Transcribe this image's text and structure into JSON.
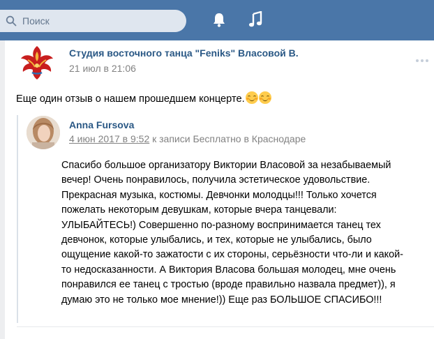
{
  "header": {
    "search_placeholder": "Поиск",
    "bar_color": "#4a76a8"
  },
  "post": {
    "author": "Студия восточного танца \"Feniks\" Власовой В.",
    "date": "21 июл в 21:06",
    "text": "Еще один отзыв о нашем прошедшем концерте."
  },
  "repost": {
    "author": "Anna Fursova",
    "date": "4 июн 2017 в 9:52",
    "context": "к записи Бесплатно в Краснодаре",
    "text": "Спасибо большое организатору Виктории Власовой за незабываемый\nвечер! Очень понравилось, получила эстетическое удовольствие.\nПрекрасная музыка, костюмы. Девчонки молодцы!!! Только хочется\nпожелать некоторым девушкам, которые вчера танцевали:\nУЛЫБАЙТЕСЬ!) Совершенно по-разному воспринимается танец тех\nдевчонок, которые улыбались, и тех, которые не улыбались, было\nощущение какой-то зажатости с их стороны, серьёзности что-ли и какой-\nто недосказанности. А Виктория Власова большая молодец, мне очень\nпонравился ее танец с тростью (вроде правильно назвала предмет)), я\nдумаю это не только мое мнение!)) Еще раз БОЛЬШОЕ СПАСИБО!!!"
  }
}
